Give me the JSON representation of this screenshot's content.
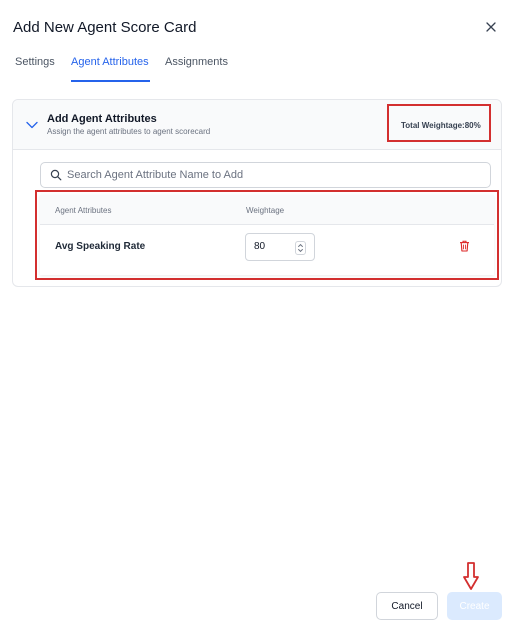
{
  "dialog": {
    "title": "Add New Agent Score Card"
  },
  "tabs": [
    {
      "label": "Settings",
      "active": false
    },
    {
      "label": "Agent Attributes",
      "active": true
    },
    {
      "label": "Assignments",
      "active": false
    }
  ],
  "panel": {
    "title": "Add Agent Attributes",
    "subtitle": "Assign the agent attributes to agent scorecard",
    "total_weightage": "Total Weightage:80%"
  },
  "search": {
    "placeholder": "Search Agent Attribute Name to Add",
    "value": ""
  },
  "table": {
    "headers": [
      "Agent Attributes",
      "Weightage"
    ],
    "rows": [
      {
        "name": "Avg Speaking Rate",
        "weightage": "80"
      }
    ]
  },
  "footer": {
    "cancel_label": "Cancel",
    "create_label": "Create"
  },
  "colors": {
    "accent": "#2563eb",
    "highlight_box": "#d32f2f",
    "delete_icon": "#dc2626",
    "create_disabled_bg": "#dbeafe"
  }
}
